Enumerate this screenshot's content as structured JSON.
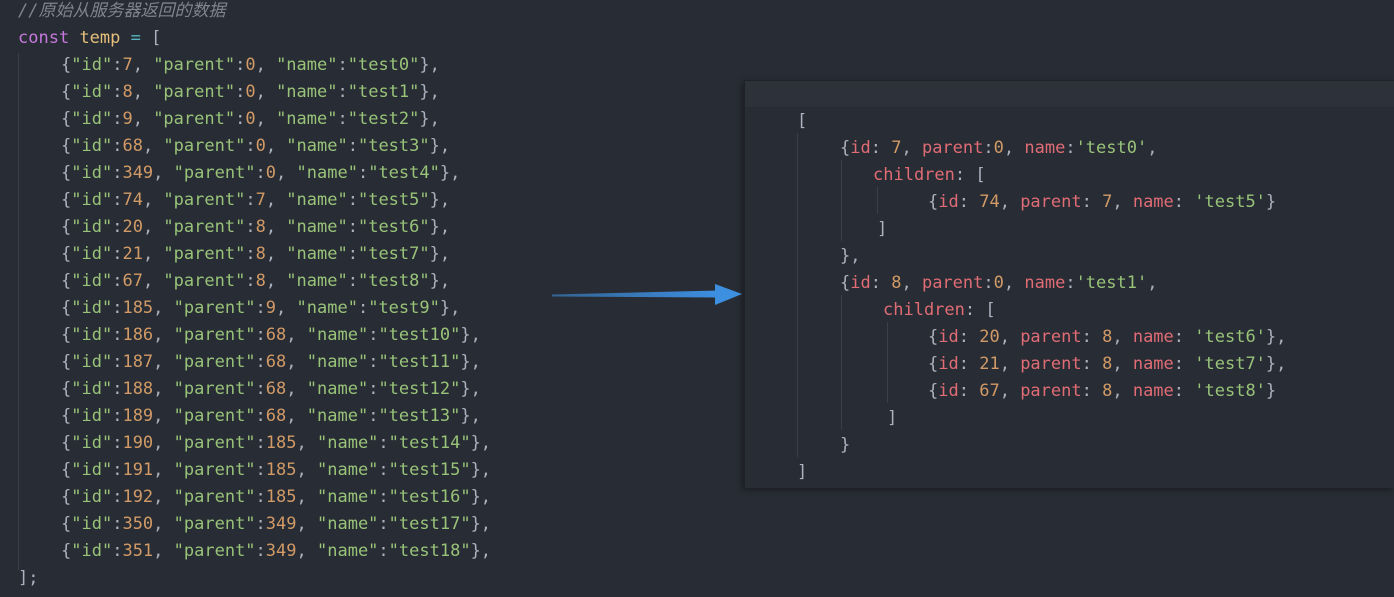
{
  "left": {
    "comment": "//原始从服务器返回的数据",
    "decl": {
      "keyword": "const",
      "name": "temp",
      "op": "=",
      "open": "["
    },
    "items": [
      {
        "id": "7",
        "parent": "0",
        "name": "\"test0\""
      },
      {
        "id": "8",
        "parent": "0",
        "name": "\"test1\""
      },
      {
        "id": "9",
        "parent": "0",
        "name": "\"test2\""
      },
      {
        "id": "68",
        "parent": "0",
        "name": "\"test3\""
      },
      {
        "id": "349",
        "parent": "0",
        "name": "\"test4\""
      },
      {
        "id": "74",
        "parent": "7",
        "name": "\"test5\""
      },
      {
        "id": "20",
        "parent": "8",
        "name": "\"test6\""
      },
      {
        "id": "21",
        "parent": "8",
        "name": "\"test7\""
      },
      {
        "id": "67",
        "parent": "8",
        "name": "\"test8\""
      },
      {
        "id": "185",
        "parent": "9",
        "name": "\"test9\""
      },
      {
        "id": "186",
        "parent": "68",
        "name": "\"test10\""
      },
      {
        "id": "187",
        "parent": "68",
        "name": "\"test11\""
      },
      {
        "id": "188",
        "parent": "68",
        "name": "\"test12\""
      },
      {
        "id": "189",
        "parent": "68",
        "name": "\"test13\""
      },
      {
        "id": "190",
        "parent": "185",
        "name": "\"test14\""
      },
      {
        "id": "191",
        "parent": "185",
        "name": "\"test15\""
      },
      {
        "id": "192",
        "parent": "185",
        "name": "\"test16\""
      },
      {
        "id": "350",
        "parent": "349",
        "name": "\"test17\""
      },
      {
        "id": "351",
        "parent": "349",
        "name": "\"test18\""
      }
    ],
    "close": "];",
    "keys": {
      "id": "\"id\"",
      "parent": "\"parent\"",
      "name": "\"name\""
    }
  },
  "right": {
    "open": "[",
    "close": "]",
    "nodes": [
      {
        "id": "7",
        "parent": "0",
        "name": "'test0'",
        "children": [
          {
            "id": "74",
            "parent": "7",
            "name": "'test5'"
          }
        ]
      },
      {
        "id": "8",
        "parent": "0",
        "name": "'test1'",
        "children": [
          {
            "id": "20",
            "parent": "8",
            "name": "'test6'"
          },
          {
            "id": "21",
            "parent": "8",
            "name": "'test7'"
          },
          {
            "id": "67",
            "parent": "8",
            "name": "'test8'"
          }
        ]
      }
    ],
    "keys": {
      "id": "id",
      "parent": "parent",
      "name": "name",
      "children": "children"
    }
  },
  "colors": {
    "background": "#282c34",
    "keyword": "#c678dd",
    "variable": "#e5c07b",
    "string": "#98c379",
    "number": "#d19a66",
    "property": "#e06c75",
    "comment": "#7f848e",
    "arrow": "#3d8fe0"
  },
  "icons": {
    "arrow": "right-arrow-icon"
  }
}
